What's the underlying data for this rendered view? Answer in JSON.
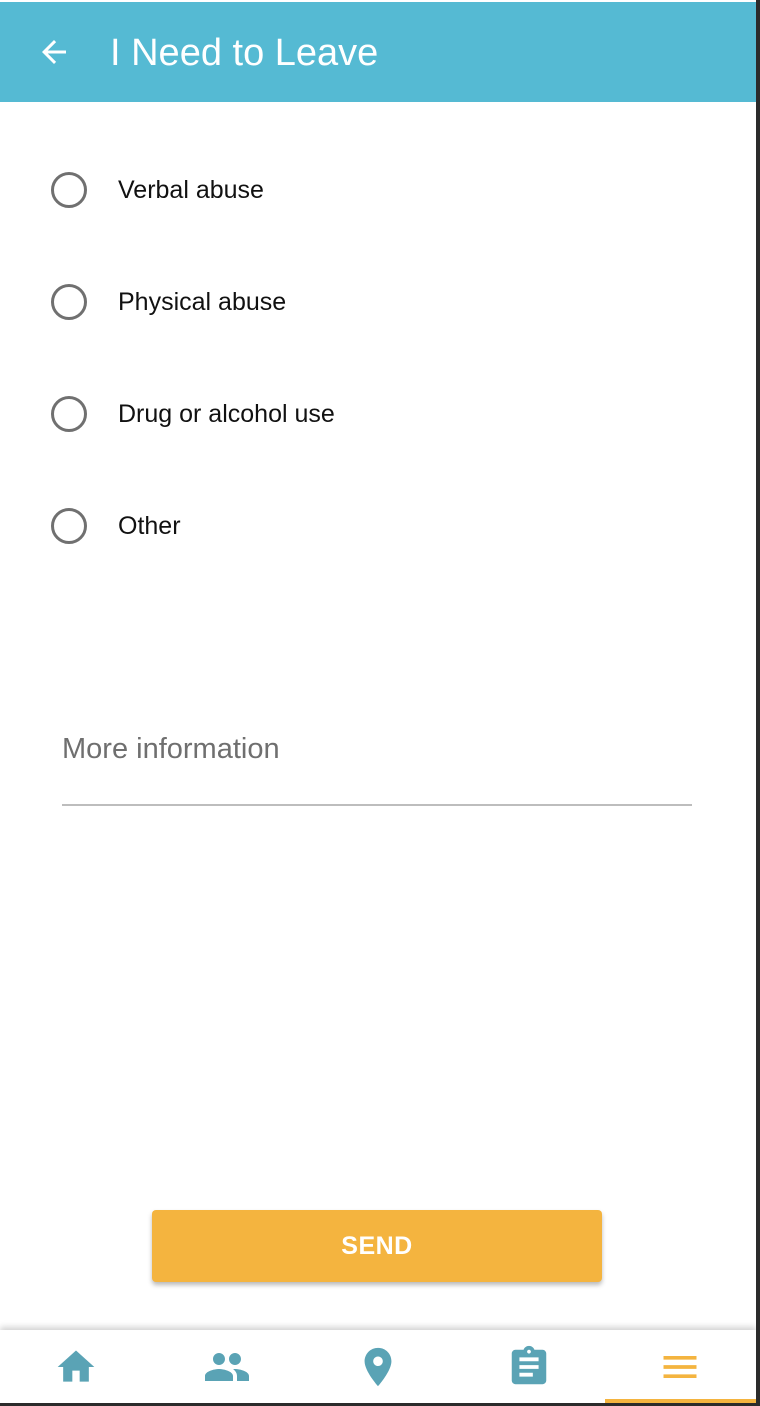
{
  "header": {
    "title": "I Need to Leave",
    "back_icon": "arrow-left-icon"
  },
  "reasons": [
    {
      "label": "Verbal abuse",
      "selected": false
    },
    {
      "label": "Physical abuse",
      "selected": false
    },
    {
      "label": "Drug or alcohol use",
      "selected": false
    },
    {
      "label": "Other",
      "selected": false
    }
  ],
  "more_info": {
    "placeholder": "More information",
    "value": ""
  },
  "send_label": "SEND",
  "nav": [
    {
      "icon": "home-icon",
      "active": false
    },
    {
      "icon": "people-icon",
      "active": false
    },
    {
      "icon": "location-pin-icon",
      "active": false
    },
    {
      "icon": "clipboard-icon",
      "active": false
    },
    {
      "icon": "menu-icon",
      "active": true
    }
  ],
  "colors": {
    "appbar": "#55bad3",
    "accent": "#f4b43f",
    "nav_icon": "#5aa3b5"
  }
}
